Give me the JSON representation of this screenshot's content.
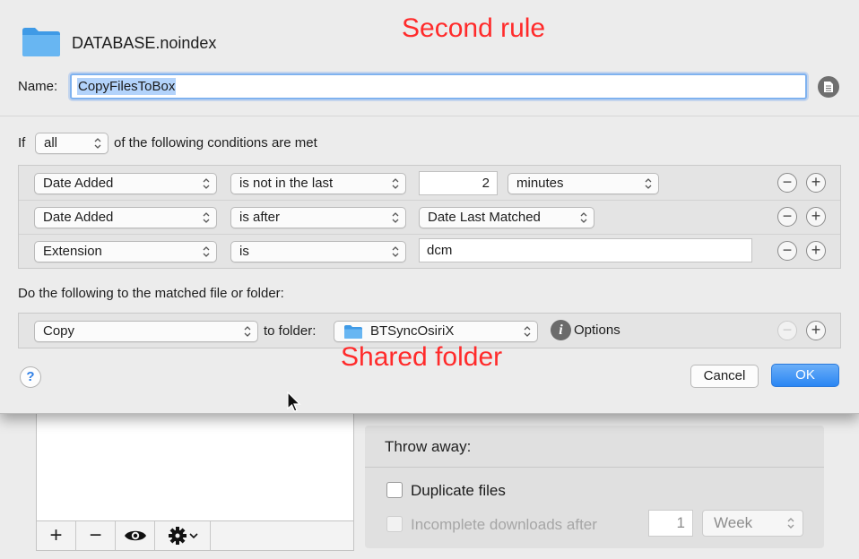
{
  "annotations": {
    "top": "Second rule",
    "folder": "Shared folder"
  },
  "header": {
    "folder_name": "DATABASE.noindex",
    "folder_icon": "folder-icon"
  },
  "name_field": {
    "label": "Name:",
    "value": "CopyFilesToBox"
  },
  "match": {
    "prefix": "If",
    "mode": "all",
    "suffix": "of the following conditions are met"
  },
  "conditions": [
    {
      "attribute": "Date Added",
      "operator": "is not in the last",
      "value": "2",
      "unit": "minutes"
    },
    {
      "attribute": "Date Added",
      "operator": "is after",
      "value": "Date Last Matched"
    },
    {
      "attribute": "Extension",
      "operator": "is",
      "value": "dcm"
    }
  ],
  "actions_section": {
    "label": "Do the following to the matched file or folder:",
    "action": "Copy",
    "to_folder_label": "to folder:",
    "folder": "BTSyncOsiriX",
    "options_label": "Options"
  },
  "buttons": {
    "help": "?",
    "cancel": "Cancel",
    "ok": "OK",
    "remove": "−",
    "add": "+"
  },
  "background": {
    "toolbar": {
      "add": "+",
      "remove": "−",
      "eye_icon": "eye-icon",
      "gear_icon": "gear-icon"
    },
    "throw_away": {
      "title": "Throw away:",
      "duplicate_files": "Duplicate files",
      "incomplete_downloads": "Incomplete downloads after",
      "count": "1",
      "period": "Week"
    }
  },
  "colors": {
    "annotation": "#ff2b2b",
    "accent": "#2a86f3",
    "folder": "#5aaef0"
  }
}
